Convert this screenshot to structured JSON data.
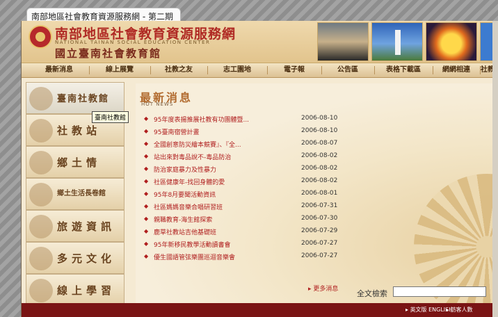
{
  "window": {
    "title": "南部地區社會教育資源服務網 - 第二期"
  },
  "header": {
    "site_title": "南部地區社會教育資源服務網",
    "site_title_en": "NATIONAL TAINAN SOCIAL EDUCATION CENTER",
    "site_subtitle": "國立臺南社會教育館"
  },
  "menu": {
    "items": [
      "最新消息",
      "線上展覽",
      "社教之友",
      "志工園地",
      "電子報",
      "公告區",
      "表格下載區",
      "網網相連",
      "社教"
    ]
  },
  "sidebar": {
    "items": [
      {
        "label": "臺南社教館",
        "active": true
      },
      {
        "label": "社教站"
      },
      {
        "label": "鄉土情"
      },
      {
        "label": "鄉土生活長卷館"
      },
      {
        "label": "旅遊資訊"
      },
      {
        "label": "多元文化"
      },
      {
        "label": "線上學習"
      }
    ],
    "tooltip": "臺南社教館"
  },
  "news": {
    "title": "最新消息",
    "subtitle": "HOT NEWS",
    "items": [
      {
        "title": "95年度表揚推展社教有功團體暨...",
        "date": "2006-08-10"
      },
      {
        "title": "95臺南宿營計畫",
        "date": "2006-08-10"
      },
      {
        "title": "全國創意防災繪本競賽』、『全...",
        "date": "2006-08-07"
      },
      {
        "title": "站出來對毒品說不-毒品防治",
        "date": "2006-08-02"
      },
      {
        "title": "防治家庭暴力及性暴力",
        "date": "2006-08-02"
      },
      {
        "title": "社區健康年-找回身體的愛",
        "date": "2006-08-02"
      },
      {
        "title": "95年8月要聞活動資訊",
        "date": "2006-08-01"
      },
      {
        "title": "社區媽媽音樂合唱研習班",
        "date": "2006-07-31"
      },
      {
        "title": "親職教育-海生館探索",
        "date": "2006-07-30"
      },
      {
        "title": "鹿草社教站吉他基礎班",
        "date": "2006-07-29"
      },
      {
        "title": "95年新移民教學活動讀書會",
        "date": "2006-07-27"
      },
      {
        "title": "優生國語管弦樂團巡迴音樂會",
        "date": "2006-07-27"
      }
    ],
    "more_label": "更多消息"
  },
  "search": {
    "label": "全文檢索",
    "value": ""
  },
  "footer": {
    "lang_label": "英文版 ENGLISH",
    "visitors_label": "訪客人數"
  },
  "colors": {
    "accent_red": "#b01f1f",
    "menu_text": "#4a2e10",
    "footer_bg": "#7a1414"
  }
}
